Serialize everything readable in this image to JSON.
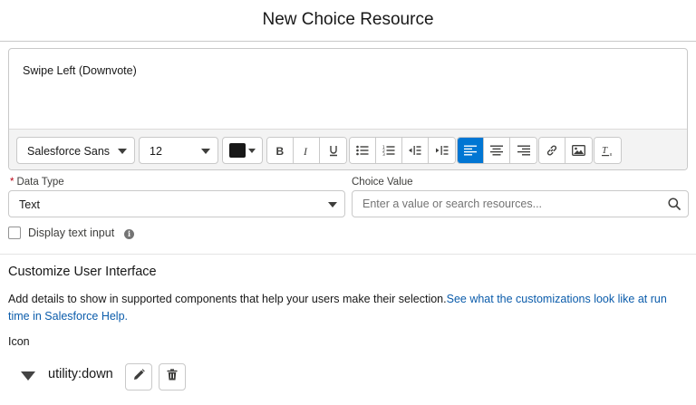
{
  "header": {
    "title": "New Choice Resource"
  },
  "editor": {
    "content": "Swipe Left (Downvote)",
    "toolbar": {
      "font_family": "Salesforce Sans",
      "font_size": "12",
      "text_color": "#181818",
      "buttons": [
        "bold-icon",
        "italic-icon",
        "underline-icon",
        "bulleted-list-icon",
        "numbered-list-icon",
        "outdent-icon",
        "indent-icon",
        "align-left-icon",
        "align-center-icon",
        "align-right-icon",
        "link-icon",
        "image-icon",
        "remove-formatting-icon"
      ]
    }
  },
  "data_type": {
    "required_marker": "*",
    "label": "Data Type",
    "value": "Text"
  },
  "choice_value": {
    "label": "Choice Value",
    "placeholder": "Enter a value or search resources..."
  },
  "display_text_input": {
    "label": "Display text input",
    "checked": false,
    "info": "i"
  },
  "customize": {
    "title": "Customize User Interface",
    "help_text": "Add details to show in supported components that help your users make their selection.",
    "help_link": "See what the customizations look like at run time in Salesforce Help."
  },
  "icon_section": {
    "label": "Icon",
    "value": "utility:down"
  },
  "colors": {
    "brand": "#0176d3",
    "link": "#0b5cab",
    "required": "#ba0517"
  }
}
